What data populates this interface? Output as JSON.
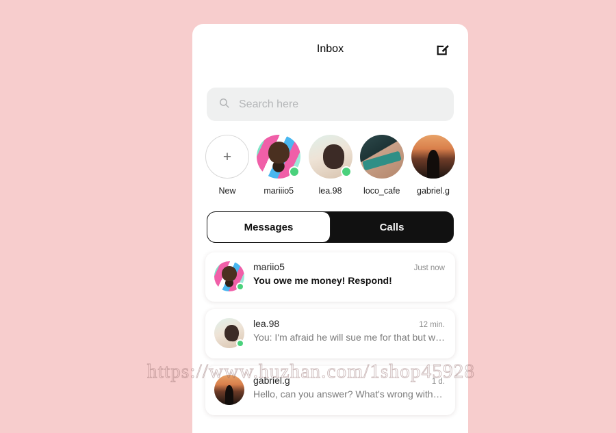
{
  "theme": {
    "background": "#f7cdcd",
    "card": "#ffffff",
    "accent_dark": "#111111",
    "online": "#4ad17c",
    "search_bg": "#eff0f0"
  },
  "header": {
    "title": "Inbox",
    "compose_icon": "compose-icon"
  },
  "search": {
    "icon": "search-icon",
    "value": "",
    "placeholder": "Search here"
  },
  "stories": [
    {
      "label": "New",
      "type": "new",
      "icon": "plus-icon",
      "online": false
    },
    {
      "label": "mariiio5",
      "type": "avatar",
      "art": "av-mariio",
      "online": true
    },
    {
      "label": "lea.98",
      "type": "avatar",
      "art": "av-lea",
      "online": true
    },
    {
      "label": "loco_cafe",
      "type": "avatar",
      "art": "av-coco",
      "online": false
    },
    {
      "label": "gabriel.g",
      "type": "avatar",
      "art": "av-gabriel",
      "online": false
    }
  ],
  "tabs": [
    {
      "label": "Messages",
      "active": true
    },
    {
      "label": "Calls",
      "active": false
    }
  ],
  "messages": [
    {
      "name": "mariio5",
      "preview": "You owe me money! Respond!",
      "time": "Just now",
      "unread": true,
      "art": "av-mariio",
      "online": true
    },
    {
      "name": "lea.98",
      "preview": "You: I'm afraid he will sue me for that but wh...",
      "time": "12 min.",
      "unread": false,
      "art": "av-lea",
      "online": true
    },
    {
      "name": "gabriel.g",
      "preview": "Hello, can you answer? What's wrong with yo...",
      "time": "1 d.",
      "unread": false,
      "art": "av-gabriel",
      "online": false
    }
  ],
  "watermark": {
    "text": "https://www.huzhan.com/1shop45928"
  }
}
